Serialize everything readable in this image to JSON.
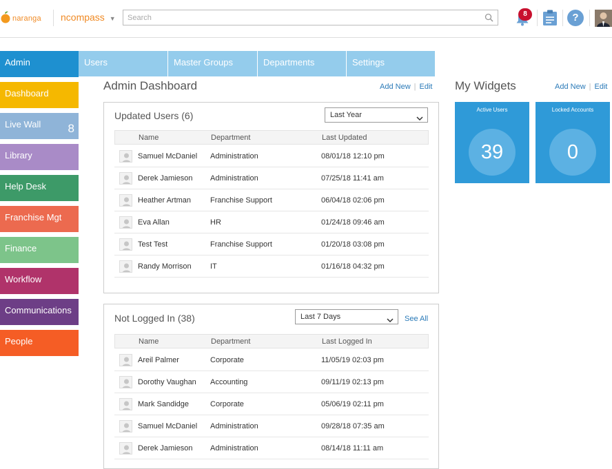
{
  "header": {
    "logo_text": "naranga",
    "app_switcher_label": "ncompass",
    "search_placeholder": "Search",
    "notification_count": "8",
    "help_label": "?"
  },
  "sidebar": {
    "items": [
      {
        "label": "Admin",
        "color": "#1e90d0"
      },
      {
        "label": "Dashboard",
        "color": "#f5b800"
      },
      {
        "label": "Live Wall",
        "color": "#8fb4d8",
        "count": "8"
      },
      {
        "label": "Library",
        "color": "#a98bc7"
      },
      {
        "label": "Help Desk",
        "color": "#3d9a68"
      },
      {
        "label": "Franchise Mgt",
        "color": "#ec6a4f"
      },
      {
        "label": "Finance",
        "color": "#7dc48a"
      },
      {
        "label": "Workflow",
        "color": "#b0336a"
      },
      {
        "label": "Communications",
        "color": "#6d3e86"
      },
      {
        "label": "People",
        "color": "#f55d25"
      }
    ]
  },
  "tabs": [
    "Users",
    "Master Groups",
    "Departments",
    "Settings"
  ],
  "admin_dashboard": {
    "title": "Admin Dashboard",
    "add_new": "Add New",
    "edit": "Edit"
  },
  "updated_users": {
    "title": "Updated Users (6)",
    "filter": "Last Year",
    "columns": [
      "Name",
      "Department",
      "Last Updated"
    ],
    "rows": [
      [
        "Samuel McDaniel",
        "Administration",
        "08/01/18 12:10 pm"
      ],
      [
        "Derek Jamieson",
        "Administration",
        "07/25/18 11:41 am"
      ],
      [
        "Heather Artman",
        "Franchise Support",
        "06/04/18 02:06 pm"
      ],
      [
        "Eva Allan",
        "HR",
        "01/24/18 09:46 am"
      ],
      [
        "Test Test",
        "Franchise Support",
        "01/20/18 03:08 pm"
      ],
      [
        "Randy Morrison",
        "IT",
        "01/16/18 04:32 pm"
      ]
    ]
  },
  "not_logged_in": {
    "title": "Not Logged In (38)",
    "filter": "Last 7 Days",
    "see_all": "See All",
    "columns": [
      "Name",
      "Department",
      "Last Logged In"
    ],
    "rows": [
      [
        "Areil Palmer",
        "Corporate",
        "11/05/19 02:03 pm"
      ],
      [
        "Dorothy Vaughan",
        "Accounting",
        "09/11/19 02:13 pm"
      ],
      [
        "Mark Sandidge",
        "Corporate",
        "05/06/19 02:11 pm"
      ],
      [
        "Samuel McDaniel",
        "Administration",
        "09/28/18 07:35 am"
      ],
      [
        "Derek Jamieson",
        "Administration",
        "08/14/18 11:11 am"
      ]
    ]
  },
  "widgets": {
    "title": "My Widgets",
    "add_new": "Add New",
    "edit": "Edit",
    "items": [
      {
        "label": "Active Users",
        "value": "39"
      },
      {
        "label": "Locked Accounts",
        "value": "0"
      }
    ]
  },
  "colors": {
    "brand_orange": "#f08a24",
    "tab_blue": "#94ccec",
    "widget_blue": "#2f9ad8",
    "link_blue": "#2a7ab8",
    "badge_red": "#c8102e"
  }
}
